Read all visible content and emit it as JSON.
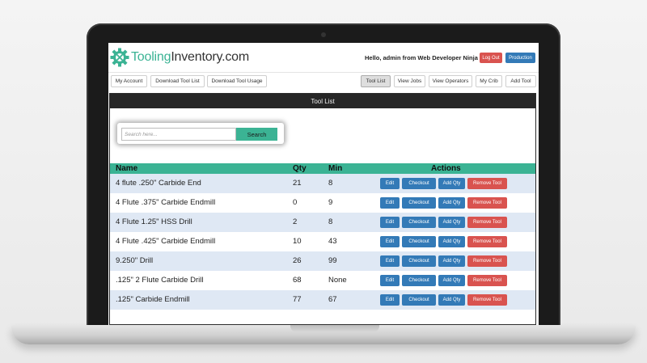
{
  "header": {
    "logo_part1": "Tooling",
    "logo_part2": "Inventory.com",
    "greeting": "Hello, admin from Web Developer Ninja",
    "logout_label": "Log Out",
    "production_label": "Production"
  },
  "toolbar": {
    "my_account": "My Account",
    "download_tool_list": "Download Tool List",
    "download_tool_usage": "Download Tool Usage",
    "tool_list": "Tool List",
    "view_jobs": "View Jobs",
    "view_operators": "View Operators",
    "my_crib": "My Crib",
    "add_tool": "Add Tool"
  },
  "panel": {
    "title": "Tool List"
  },
  "search": {
    "placeholder": "Search here...",
    "button_label": "Search"
  },
  "table": {
    "headers": {
      "name": "Name",
      "qty": "Qty",
      "min": "Min",
      "actions": "Actions"
    },
    "action_labels": {
      "edit": "Edit",
      "checkout": "Checkout",
      "add_qty": "Add Qty",
      "remove": "Remove Tool"
    },
    "rows": [
      {
        "name": "4 flute .250\" Carbide End",
        "qty": "21",
        "min": "8"
      },
      {
        "name": "4 Flute .375\" Carbide Endmill",
        "qty": "0",
        "min": "9"
      },
      {
        "name": "4 Flute 1.25\" HSS Drill",
        "qty": "2",
        "min": "8"
      },
      {
        "name": "4 Flute .425\" Carbide Endmill",
        "qty": "10",
        "min": "43"
      },
      {
        "name": "9.250\" Drill",
        "qty": "26",
        "min": "99"
      },
      {
        "name": ".125\" 2 Flute Carbide Drill",
        "qty": "68",
        "min": "None"
      },
      {
        "name": ".125\" Carbide Endmill",
        "qty": "77",
        "min": "67"
      }
    ]
  },
  "colors": {
    "brand_green": "#3bb394",
    "primary_blue": "#337ab7",
    "danger_red": "#d9534f",
    "row_stripe": "#dfe8f4"
  }
}
